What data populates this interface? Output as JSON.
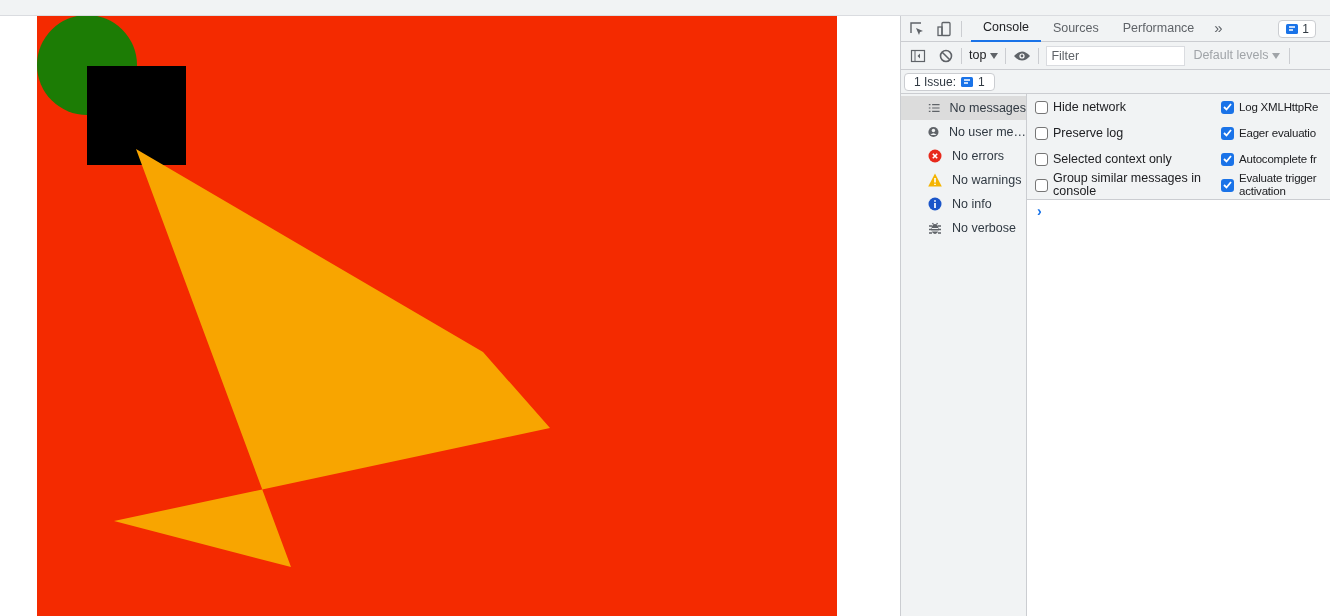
{
  "devtools": {
    "tabs": [
      {
        "label": "Console",
        "selected": true
      },
      {
        "label": "Sources",
        "selected": false
      },
      {
        "label": "Performance",
        "selected": false
      }
    ],
    "more_tabs": "»",
    "issues_badge": "1",
    "toolbar": {
      "context": "top",
      "filter_placeholder": "Filter",
      "levels": "Default levels"
    },
    "issues_bar": {
      "label": "1 Issue:",
      "count": "1"
    },
    "sidebar": [
      {
        "kind": "messages",
        "label": "No messages",
        "selected": true
      },
      {
        "kind": "user",
        "label": "No user me…",
        "selected": false
      },
      {
        "kind": "errors",
        "label": "No errors",
        "selected": false
      },
      {
        "kind": "warnings",
        "label": "No warnings",
        "selected": false
      },
      {
        "kind": "info",
        "label": "No info",
        "selected": false
      },
      {
        "kind": "verbose",
        "label": "No verbose",
        "selected": false
      }
    ],
    "settings_left": [
      {
        "label": "Hide network",
        "checked": false
      },
      {
        "label": "Preserve log",
        "checked": false
      },
      {
        "label": "Selected context only",
        "checked": false
      },
      {
        "label": "Group similar messages in console",
        "checked": false
      }
    ],
    "settings_right": [
      {
        "label": "Log XMLHttpRe",
        "checked": true
      },
      {
        "label": "Eager evaluatio",
        "checked": true
      },
      {
        "label": "Autocomplete fr",
        "checked": true
      },
      {
        "label": "Evaluate trigger activation",
        "checked": true
      }
    ],
    "prompt": "›"
  }
}
